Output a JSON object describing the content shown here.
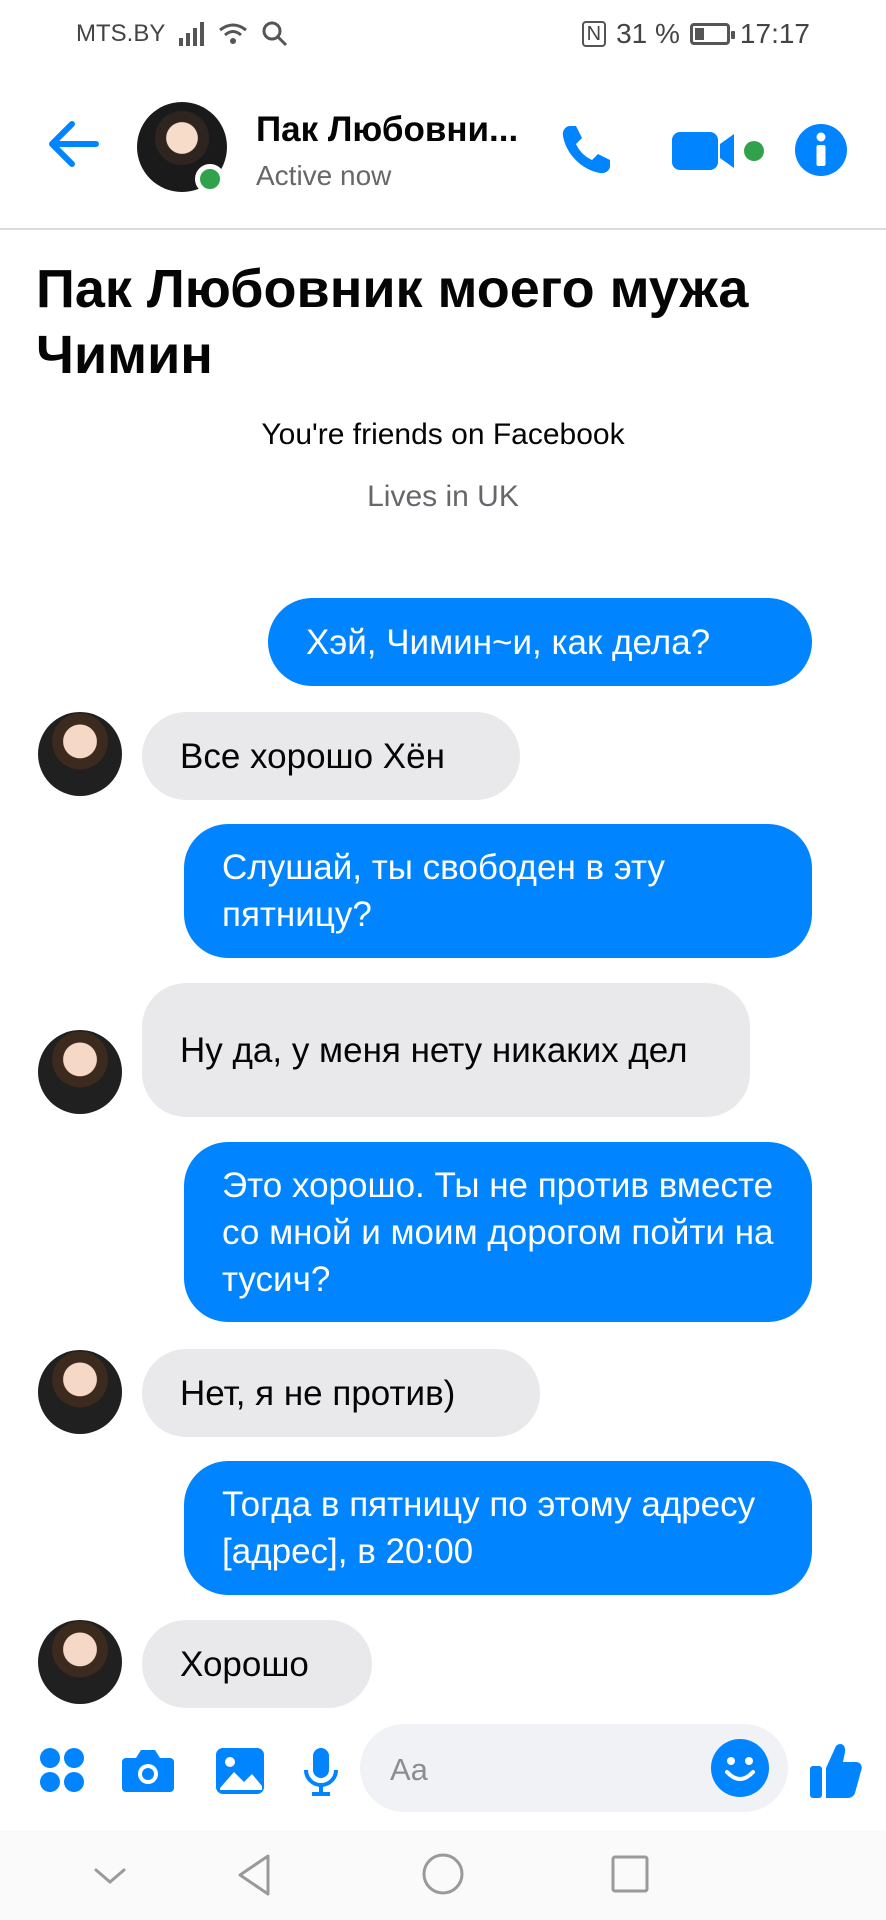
{
  "status_bar": {
    "carrier": "MTS.BY",
    "nfc": "N",
    "battery_percent": "31 %",
    "battery_level": 0.31,
    "time": "17:17"
  },
  "header": {
    "name": "Пак Любовни...",
    "status": "Active now",
    "icons": [
      "back-arrow-icon",
      "phone-icon",
      "video-camera-icon",
      "info-icon"
    ]
  },
  "intro": {
    "title": "Пак Любовник моего мужа Чимин",
    "friends": "You're friends on Facebook",
    "location": "Lives in UK"
  },
  "messages": [
    {
      "from": "me",
      "text": "Хэй, Чимин~и, как дела?"
    },
    {
      "from": "them",
      "text": "Все хорошо Хён"
    },
    {
      "from": "me",
      "text": "Слушай, ты свободен в эту пятницу?"
    },
    {
      "from": "them",
      "text": "Ну да, у меня нету никаких дел"
    },
    {
      "from": "me",
      "text": "Это хорошо. Ты не против вместе со мной и моим дорогом пойти на тусич?"
    },
    {
      "from": "them",
      "text": "Нет, я не против)"
    },
    {
      "from": "me",
      "text": "Тогда в пятницу по этому адресу [адрес], в 20:00"
    },
    {
      "from": "them",
      "text": "Хорошо"
    }
  ],
  "composer": {
    "placeholder": "Aa",
    "icons": [
      "apps-grid-icon",
      "camera-icon",
      "gallery-icon",
      "microphone-icon",
      "emoji-icon",
      "thumbs-up-icon"
    ]
  },
  "colors": {
    "accent": "#0084ff",
    "incoming_bubble": "#e9e9eb",
    "online": "#31a24c"
  }
}
